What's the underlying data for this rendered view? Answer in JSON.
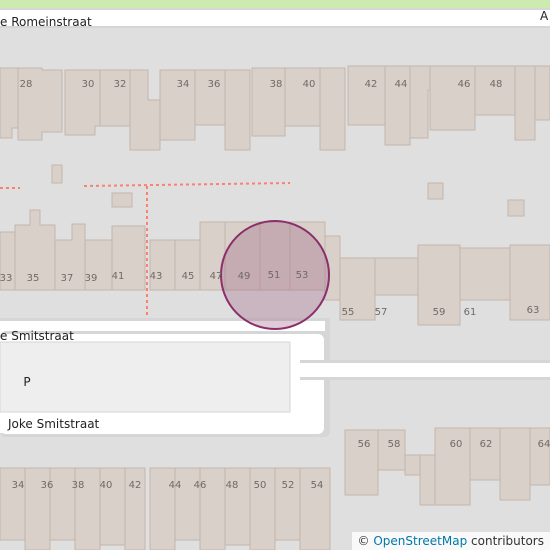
{
  "streets": {
    "top": "e Romeinstraat",
    "top_right_fragment": "A",
    "middle": "e Smitstraat",
    "lower": "Joke Smitstraat"
  },
  "parking_label": "P",
  "house_numbers": {
    "top_row": [
      "28",
      "30",
      "32",
      "34",
      "36",
      "38",
      "40",
      "42",
      "44",
      "46",
      "48"
    ],
    "middle_row": [
      "33",
      "35",
      "37",
      "39",
      "41",
      "43",
      "45",
      "47",
      "49",
      "51",
      "53",
      "55",
      "57",
      "59",
      "61",
      "63"
    ],
    "bottom_right_row": [
      "56",
      "58",
      "60",
      "62",
      "64"
    ],
    "bottom_left_row": [
      "34",
      "36",
      "38",
      "40",
      "42",
      "44",
      "46",
      "48",
      "50",
      "52",
      "54"
    ]
  },
  "attribution": {
    "symbol": "©",
    "link_text": "OpenStreetMap",
    "suffix": " contributors"
  },
  "colors": {
    "background": "#e0dfdf",
    "building_fill": "#d9d0c9",
    "building_stroke": "#c4b6ab",
    "road": "#ffffff",
    "road_casing": "#d6d6d6",
    "parking": "#eeeeee",
    "footpath": "#fa8072",
    "marker_fill": "#a06a8a",
    "marker_stroke": "#8a2f6b",
    "parking_label": "#0092da",
    "green_strip": "#cdebb0"
  }
}
